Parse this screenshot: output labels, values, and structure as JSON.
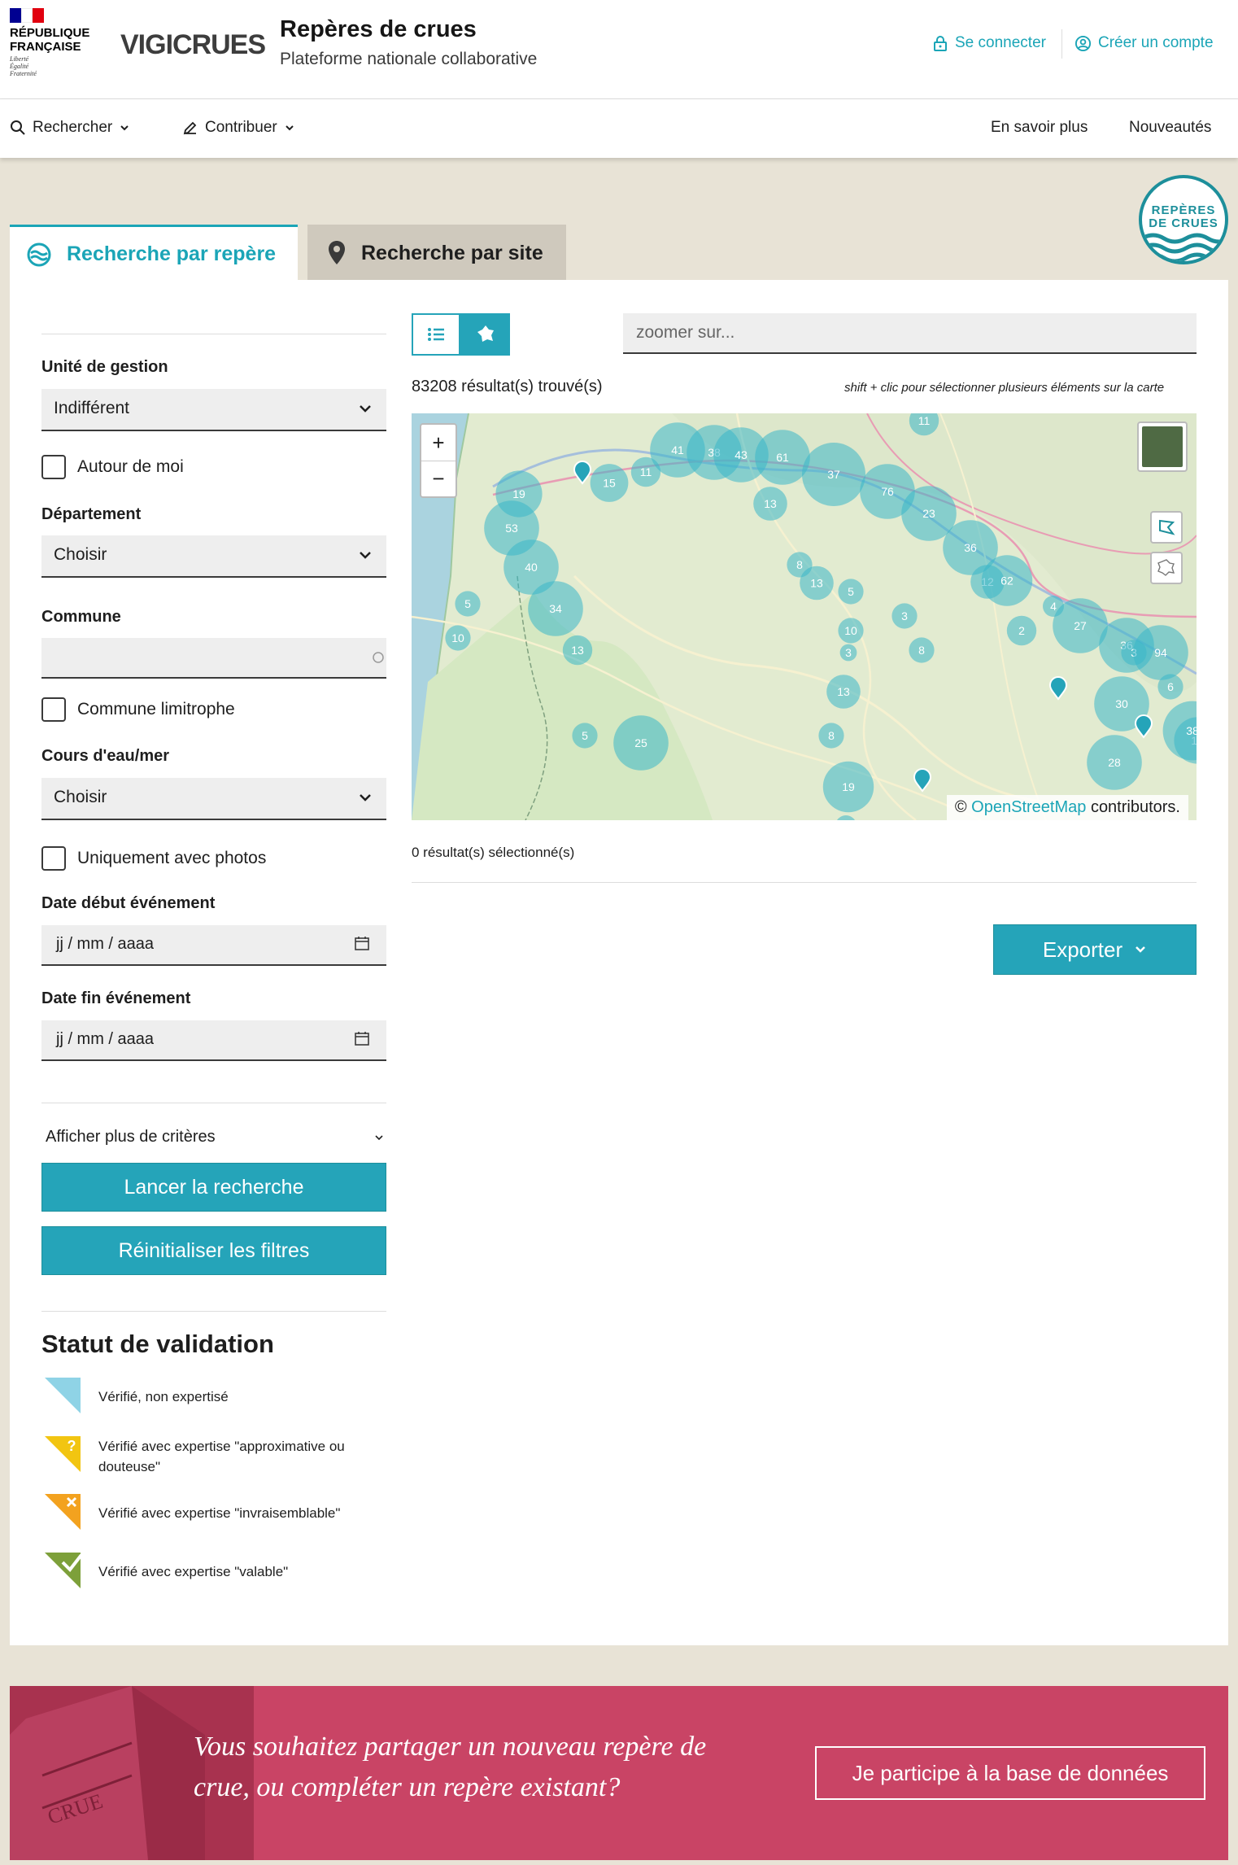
{
  "header": {
    "gov_logo_text": "RÉPUBLIQUE\nFRANÇAISE",
    "gov_devise": "Liberté\nÉgalité\nFraternité",
    "brand": "VIGICRUES",
    "site_title": "Repères de crues",
    "site_subtitle": "Plateforme nationale collaborative",
    "login": "Se connecter",
    "signup": "Créer un compte"
  },
  "nav": {
    "search": "Rechercher",
    "contribute": "Contribuer",
    "learn_more": "En savoir plus",
    "news": "Nouveautés"
  },
  "badge": {
    "line1": "REPÈRES",
    "line2": "DE CRUES"
  },
  "tabs": {
    "by_mark": "Recherche par repère",
    "by_site": "Recherche par site"
  },
  "filters": {
    "management_unit_label": "Unité de gestion",
    "management_unit_value": "Indifférent",
    "around_me": "Autour de moi",
    "department_label": "Département",
    "department_value": "Choisir",
    "commune_label": "Commune",
    "commune_value": "",
    "adjacent_commune": "Commune limitrophe",
    "waterway_label": "Cours d'eau/mer",
    "waterway_value": "Choisir",
    "only_photos": "Uniquement avec photos",
    "start_date_label": "Date début événement",
    "start_date_placeholder": "jj / mm / aaaa",
    "end_date_label": "Date fin événement",
    "end_date_placeholder": "jj / mm / aaaa",
    "more_criteria": "Afficher plus de critères",
    "search_button": "Lancer la recherche",
    "reset_button": "Réinitialiser les filtres"
  },
  "legend": {
    "title": "Statut de validation",
    "items": [
      {
        "label": "Vérifié, non expertisé",
        "color": "#8fd3e6"
      },
      {
        "label": "Vérifié avec expertise \"approximative ou douteuse\"",
        "color": "#f2c511"
      },
      {
        "label": "Vérifié avec expertise \"invraisemblable\"",
        "color": "#f3a21f"
      },
      {
        "label": "Vérifié avec expertise \"valable\"",
        "color": "#7da03a"
      }
    ]
  },
  "results": {
    "zoom_placeholder": "zoomer sur...",
    "count": "83208 résultat(s) trouvé(s)",
    "hint": "shift + clic pour sélectionner plusieurs éléments sur la carte",
    "selected": "0 résultat(s) sélectionné(s)",
    "export": "Exporter"
  },
  "map": {
    "attribution_prefix": "©",
    "attribution_link": "OpenStreetMap",
    "attribution_suffix": "contributors.",
    "zoom_in": "+",
    "zoom_out": "−",
    "clusters": [
      "11",
      "41",
      "38",
      "43",
      "61",
      "19",
      "15",
      "11",
      "37",
      "76",
      "13",
      "53",
      "23",
      "36",
      "40",
      "12",
      "62",
      "8",
      "13",
      "5",
      "34",
      "5",
      "10",
      "13",
      "3",
      "10",
      "3",
      "8",
      "4",
      "2",
      "27",
      "36",
      "3",
      "94",
      "6",
      "13",
      "10",
      "30",
      "25",
      "5",
      "8",
      "38",
      "28",
      "19",
      "9"
    ]
  },
  "banner": {
    "text": "Vous souhaitez partager un nouveau repère de crue, ou compléter un repère existant?",
    "button": "Je participe à la base de données"
  },
  "colors": {
    "accent": "#25a4b9",
    "banner": "#c94465",
    "page_bg": "#e8e3d6"
  }
}
